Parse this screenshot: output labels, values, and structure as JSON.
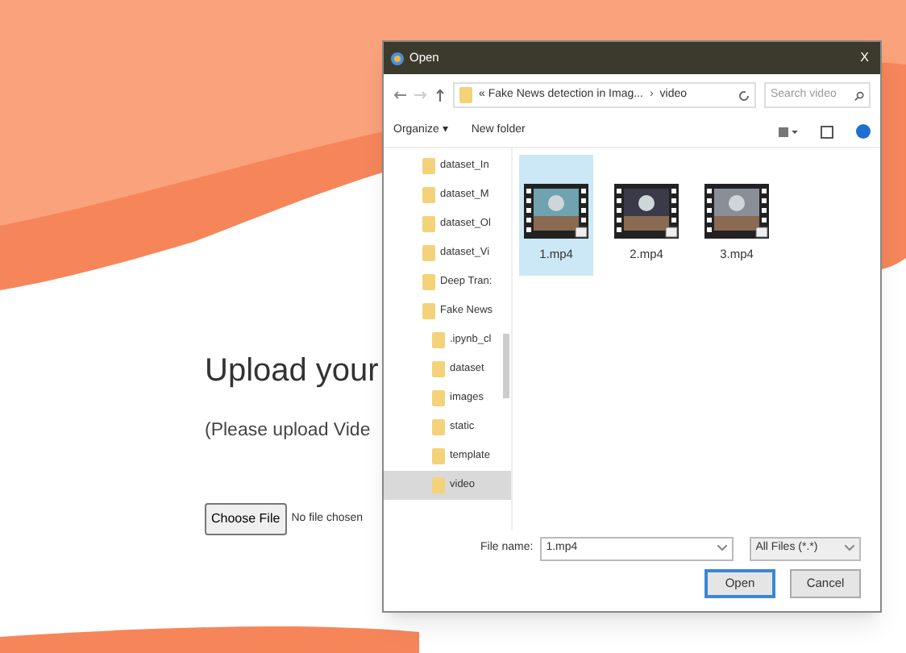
{
  "page": {
    "heading": "Upload your",
    "subheading": "(Please upload Vide",
    "file_input": {
      "button": "Choose File",
      "status": "No file chosen"
    }
  },
  "dialog": {
    "title": "Open",
    "close": "X",
    "address": {
      "path": "« Fake News detection in Imag...",
      "separator": "›",
      "current": "video"
    },
    "search": {
      "placeholder": "Search video"
    },
    "toolbar": {
      "organize": "Organize ▾",
      "new_folder": "New folder"
    },
    "tree": [
      {
        "label": "dataset_In",
        "selected": false
      },
      {
        "label": "dataset_M",
        "selected": false
      },
      {
        "label": "dataset_Ol",
        "selected": false
      },
      {
        "label": "dataset_Vi",
        "selected": false
      },
      {
        "label": "Deep Tran:",
        "selected": false
      },
      {
        "label": "Fake News",
        "selected": false,
        "children": [
          {
            "label": ".ipynb_cl",
            "selected": false
          },
          {
            "label": "dataset",
            "selected": false
          },
          {
            "label": "images",
            "selected": false
          },
          {
            "label": "static",
            "selected": false
          },
          {
            "label": "template",
            "selected": false
          },
          {
            "label": "video",
            "selected": true
          }
        ]
      }
    ],
    "files": [
      {
        "name": "1.mp4",
        "selected": true
      },
      {
        "name": "2.mp4",
        "selected": false
      },
      {
        "name": "3.mp4",
        "selected": false
      }
    ],
    "file_name": {
      "label": "File name:",
      "value": "1.mp4"
    },
    "file_type": {
      "value": "All Files (*.*)"
    },
    "buttons": [
      {
        "label": "Open",
        "kind": "primary"
      },
      {
        "label": "Cancel",
        "kind": "secondary"
      }
    ]
  }
}
